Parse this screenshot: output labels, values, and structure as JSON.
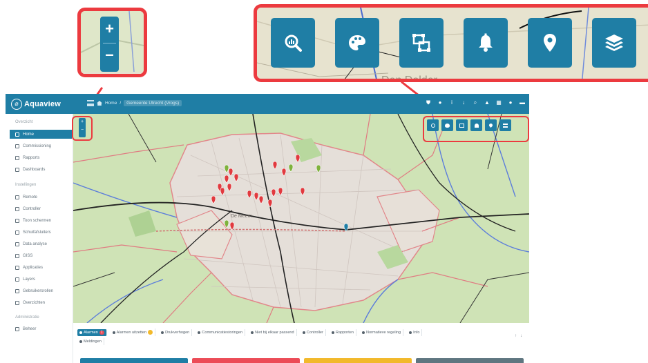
{
  "app": {
    "logo_text": "Aquaview",
    "breadcrumb": [
      "Home",
      "Gemeente Utrecht (Vrogs)"
    ]
  },
  "sidebar": {
    "sections": [
      {
        "label": "Overzicht",
        "items": [
          {
            "label": "Home",
            "active": true
          },
          {
            "label": "Commissioning"
          },
          {
            "label": "Rapports"
          },
          {
            "label": "Dashboards"
          }
        ]
      },
      {
        "label": "Instellingen",
        "items": [
          {
            "label": "Remote"
          },
          {
            "label": "Controller"
          },
          {
            "label": "Toon schermen"
          },
          {
            "label": "Schuifafsluiters"
          },
          {
            "label": "Data analyse"
          },
          {
            "label": "GISS"
          },
          {
            "label": "Applicaties"
          },
          {
            "label": "Layers"
          },
          {
            "label": "Gebruikersrollen"
          },
          {
            "label": "Overzichten"
          }
        ]
      },
      {
        "label": "Administratie",
        "items": [
          {
            "label": "Beheer"
          }
        ]
      }
    ]
  },
  "map_toolbar": [
    {
      "icon": "search-analytics-icon"
    },
    {
      "icon": "palette-icon"
    },
    {
      "icon": "transform-icon"
    },
    {
      "icon": "bell-icon"
    },
    {
      "icon": "map-marker-icon"
    },
    {
      "icon": "layers-icon"
    }
  ],
  "map_labels": {
    "zoom_label": "Den Dolder",
    "district": "De Meern"
  },
  "bottom_tabs": [
    {
      "label": "Alarmen",
      "badge": "1",
      "active": true
    },
    {
      "label": "Alarmen uitzetten",
      "badge_yellow": true
    },
    {
      "label": "Drukverhogen"
    },
    {
      "label": "Communicatiestoringen"
    },
    {
      "label": "Niet bij elkaar passend"
    },
    {
      "label": "Controller"
    },
    {
      "label": "Rapporten"
    },
    {
      "label": "Normatieve regeling"
    },
    {
      "label": "Info"
    },
    {
      "label": "Meldingen"
    }
  ],
  "colors": {
    "primary": "#1f7ea5",
    "callout": "#ec3a3f",
    "marker_red": "#e13a3f",
    "marker_green": "#7fb23d",
    "card_colors": [
      "#1f7ea5",
      "#ec4b57",
      "#f2b92b",
      "#5f7680"
    ]
  }
}
